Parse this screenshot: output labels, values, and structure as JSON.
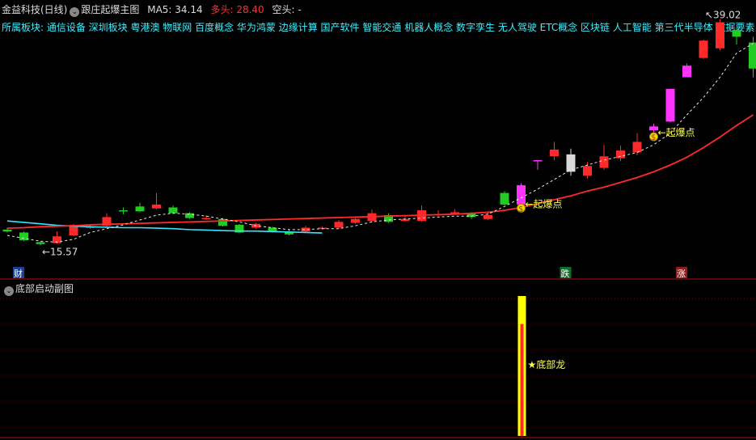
{
  "header": {
    "stock_name": "金益科技(日线)",
    "indicator_name": "跟庄起爆主图",
    "ma5_label": "MA5: 34.14",
    "bull_label": "多头: 28.40",
    "bear_label": "空头: -"
  },
  "sector_line": "所属板块: 通信设备 深圳板块 粤港澳 物联网 百度概念 华为鸿蒙 边缘计算 国产软件 智能交通 机器人概念 数字孪生 无人驾驶 ETC概念 区块链 人工智能 第三代半导体 数据要素",
  "subchart": {
    "title": "底部启动副图",
    "signal_label": "★底部龙"
  },
  "colors": {
    "up": "#ff2a2a",
    "down": "#22cc22",
    "signal": "#ff33ff",
    "doji": "#d8d8d8",
    "ma_cyan": "#33e6ff",
    "ma_red": "#ff2a2a",
    "dashed": "#e8e8e8",
    "signal_bar": "#ffff00",
    "signal_inner": "#ff2a2a"
  },
  "chart_data": {
    "type": "candlestick",
    "price_range": [
      13.5,
      39.5
    ],
    "annotations": {
      "low_marker": "15.57",
      "high_marker": "39.02",
      "burst_label_1": "起爆点",
      "burst_label_2": "起爆点",
      "tag_cai": "财",
      "tag_die": "跌",
      "tag_zhang": "涨"
    },
    "candles": [
      {
        "o": 17.2,
        "c": 17.0,
        "h": 17.4,
        "l": 16.9,
        "k": "down"
      },
      {
        "o": 16.9,
        "c": 16.1,
        "h": 17.0,
        "l": 16.0,
        "k": "down"
      },
      {
        "o": 15.9,
        "c": 15.7,
        "h": 16.0,
        "l": 15.57,
        "k": "down"
      },
      {
        "o": 15.8,
        "c": 16.5,
        "h": 17.0,
        "l": 15.7,
        "k": "up"
      },
      {
        "o": 16.6,
        "c": 17.7,
        "h": 17.8,
        "l": 16.5,
        "k": "up"
      },
      {
        "o": 17.5,
        "c": 17.5,
        "h": 17.7,
        "l": 17.3,
        "k": "up"
      },
      {
        "o": 17.6,
        "c": 18.5,
        "h": 18.9,
        "l": 17.5,
        "k": "up"
      },
      {
        "o": 19.2,
        "c": 19.1,
        "h": 19.5,
        "l": 18.8,
        "k": "down"
      },
      {
        "o": 19.6,
        "c": 19.1,
        "h": 20.0,
        "l": 19.0,
        "k": "down"
      },
      {
        "o": 19.4,
        "c": 19.8,
        "h": 21.0,
        "l": 19.3,
        "k": "up"
      },
      {
        "o": 19.5,
        "c": 18.9,
        "h": 19.7,
        "l": 18.8,
        "k": "down"
      },
      {
        "o": 18.9,
        "c": 18.4,
        "h": 19.0,
        "l": 18.3,
        "k": "down"
      },
      {
        "o": 18.4,
        "c": 18.4,
        "h": 18.7,
        "l": 18.2,
        "k": "up"
      },
      {
        "o": 18.3,
        "c": 17.6,
        "h": 18.4,
        "l": 17.5,
        "k": "down"
      },
      {
        "o": 17.7,
        "c": 16.9,
        "h": 17.8,
        "l": 16.8,
        "k": "down"
      },
      {
        "o": 17.4,
        "c": 17.8,
        "h": 17.9,
        "l": 17.3,
        "k": "up"
      },
      {
        "o": 17.4,
        "c": 17.0,
        "h": 17.5,
        "l": 16.9,
        "k": "down"
      },
      {
        "o": 17.0,
        "c": 16.7,
        "h": 17.2,
        "l": 16.6,
        "k": "down"
      },
      {
        "o": 17.0,
        "c": 17.4,
        "h": 17.6,
        "l": 16.9,
        "k": "up"
      },
      {
        "o": 17.3,
        "c": 17.4,
        "h": 17.5,
        "l": 17.2,
        "k": "up"
      },
      {
        "o": 17.4,
        "c": 18.0,
        "h": 18.2,
        "l": 17.3,
        "k": "up"
      },
      {
        "o": 17.9,
        "c": 18.3,
        "h": 18.4,
        "l": 17.8,
        "k": "up"
      },
      {
        "o": 18.1,
        "c": 18.9,
        "h": 19.3,
        "l": 18.0,
        "k": "up"
      },
      {
        "o": 18.7,
        "c": 18.0,
        "h": 18.9,
        "l": 17.9,
        "k": "down"
      },
      {
        "o": 18.1,
        "c": 18.3,
        "h": 18.6,
        "l": 18.0,
        "k": "up"
      },
      {
        "o": 18.1,
        "c": 19.2,
        "h": 19.7,
        "l": 18.0,
        "k": "up"
      },
      {
        "o": 18.8,
        "c": 18.8,
        "h": 19.2,
        "l": 18.6,
        "k": "up"
      },
      {
        "o": 19.0,
        "c": 18.9,
        "h": 19.3,
        "l": 18.8,
        "k": "up"
      },
      {
        "o": 18.9,
        "c": 18.5,
        "h": 19.0,
        "l": 18.3,
        "k": "down"
      },
      {
        "o": 18.3,
        "c": 18.7,
        "h": 19.0,
        "l": 18.2,
        "k": "up"
      },
      {
        "o": 19.8,
        "c": 21.0,
        "h": 21.2,
        "l": 19.7,
        "k": "down"
      },
      {
        "o": 19.8,
        "c": 21.8,
        "h": 22.0,
        "l": 19.7,
        "k": "signal"
      },
      {
        "o": 24.4,
        "c": 24.4,
        "h": 24.4,
        "l": 23.4,
        "k": "signal"
      },
      {
        "o": 24.8,
        "c": 25.5,
        "h": 26.3,
        "l": 24.4,
        "k": "up"
      },
      {
        "o": 23.2,
        "c": 25.0,
        "h": 25.6,
        "l": 22.8,
        "k": "doji"
      },
      {
        "o": 22.8,
        "c": 23.8,
        "h": 24.2,
        "l": 22.5,
        "k": "up"
      },
      {
        "o": 23.6,
        "c": 24.8,
        "h": 26.0,
        "l": 23.4,
        "k": "up"
      },
      {
        "o": 24.6,
        "c": 25.4,
        "h": 25.9,
        "l": 24.3,
        "k": "up"
      },
      {
        "o": 25.2,
        "c": 26.3,
        "h": 27.2,
        "l": 24.9,
        "k": "up"
      },
      {
        "o": 27.5,
        "c": 27.9,
        "h": 28.2,
        "l": 27.3,
        "k": "signal"
      },
      {
        "o": 28.4,
        "c": 31.8,
        "h": 31.8,
        "l": 28.3,
        "k": "signal"
      },
      {
        "o": 33.0,
        "c": 34.2,
        "h": 34.4,
        "l": 33.0,
        "k": "signal"
      },
      {
        "o": 35.0,
        "c": 36.8,
        "h": 36.9,
        "l": 34.9,
        "k": "up"
      },
      {
        "o": 36.0,
        "c": 38.7,
        "h": 39.02,
        "l": 35.8,
        "k": "up"
      },
      {
        "o": 37.9,
        "c": 37.2,
        "h": 38.0,
        "l": 36.4,
        "k": "down"
      },
      {
        "o": 36.6,
        "c": 33.9,
        "h": 37.2,
        "l": 33.0,
        "k": "down"
      }
    ],
    "ma_cyan": [
      18.1,
      17.95,
      17.8,
      17.65,
      17.55,
      17.5,
      17.45,
      17.4,
      17.4,
      17.35,
      17.3,
      17.2,
      17.15,
      17.1,
      17.05,
      17.05,
      17.0,
      16.95,
      16.9,
      16.85
    ],
    "ma_red": [
      17.35,
      17.4,
      17.5,
      17.55,
      17.6,
      17.7,
      17.75,
      17.8,
      17.85,
      17.9,
      17.95,
      18.0,
      18.05,
      18.1,
      18.15,
      18.2,
      18.25,
      18.3,
      18.35,
      18.4,
      18.45,
      18.5,
      18.55,
      18.6,
      18.65,
      18.7,
      18.75,
      18.8,
      18.9,
      19.0,
      19.2,
      19.5,
      19.9,
      20.3,
      20.7,
      21.2,
      21.6,
      22.1,
      22.6,
      23.2,
      23.9,
      24.7,
      25.7,
      26.8,
      28.0,
      29.1
    ],
    "dashed_line": [
      16.6,
      16.3,
      16.0,
      15.9,
      16.2,
      16.9,
      17.3,
      17.7,
      18.2,
      18.7,
      18.9,
      18.8,
      18.6,
      18.3,
      18.0,
      17.6,
      17.4,
      17.2,
      17.2,
      17.3,
      17.3,
      17.6,
      18.0,
      18.2,
      18.3,
      18.4,
      18.5,
      18.6,
      18.6,
      18.8,
      19.6,
      20.5,
      21.4,
      22.4,
      23.4,
      23.9,
      24.4,
      24.8,
      25.2,
      26.0,
      27.2,
      29.1,
      30.9,
      33.0,
      35.5,
      36.5
    ],
    "sub_bar": {
      "index": 31,
      "outer": 1.0,
      "inner": 0.8
    }
  }
}
